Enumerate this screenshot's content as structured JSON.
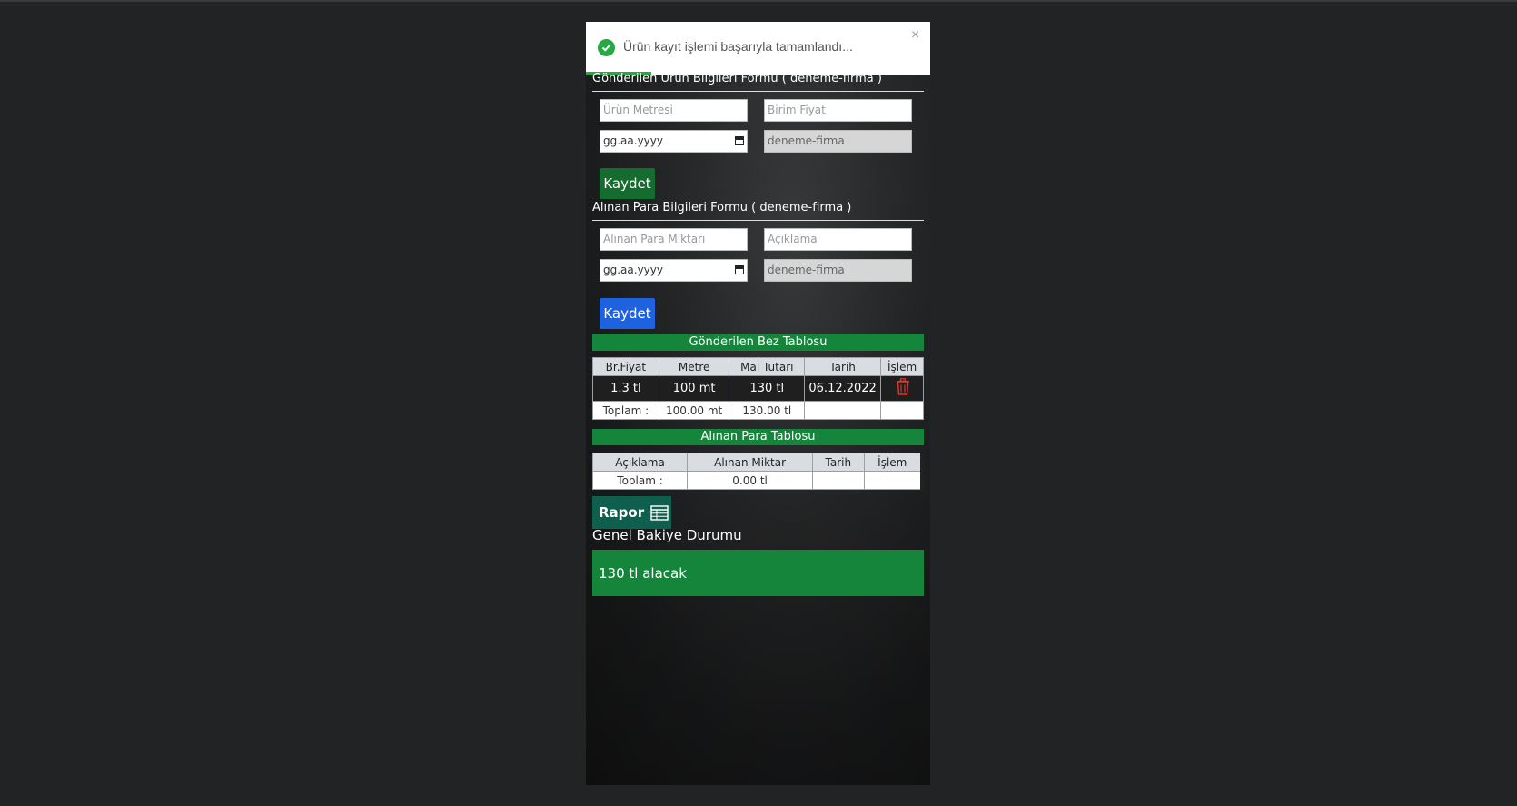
{
  "toast": {
    "message": "Ürün kayıt işlemi başarıyla tamamlandı...",
    "close": "×",
    "progress": 0.19
  },
  "product_form": {
    "title": "Gönderilen Ürün Bilgileri Formu ( deneme-firma )",
    "meter_placeholder": "Ürün Metresi",
    "unit_price_placeholder": "Birim Fiyat",
    "date_placeholder": "gg.aa.yyyy",
    "firm_value": "deneme-firma",
    "save_label": "Kaydet"
  },
  "payment_form": {
    "title": "Alınan Para Bilgileri Formu ( deneme-firma )",
    "amount_placeholder": "Alınan Para Miktarı",
    "description_placeholder": "Açıklama",
    "date_placeholder": "gg.aa.yyyy",
    "firm_value": "deneme-firma",
    "save_label": "Kaydet"
  },
  "sent_table": {
    "title": "Gönderilen Bez Tablosu",
    "headers": [
      "Br.Fiyat",
      "Metre",
      "Mal Tutarı",
      "Tarih",
      "İşlem"
    ],
    "rows": [
      {
        "unit_price": "1.3 tl",
        "meter": "100 mt",
        "amount": "130 tl",
        "date": "06.12.2022",
        "action_icon": "trash-icon"
      }
    ],
    "total": {
      "label": "Toplam :",
      "meter": "100.00 mt",
      "amount": "130.00 tl"
    }
  },
  "received_table": {
    "title": "Alınan Para Tablosu",
    "headers": [
      "Açıklama",
      "Alınan Miktar",
      "Tarih",
      "İşlem"
    ],
    "total": {
      "label": "Toplam :",
      "amount": "0.00 tl"
    }
  },
  "report": {
    "label": "Rapor",
    "icon": "table-icon"
  },
  "balance": {
    "title": "Genel Bakiye Durumu",
    "value": "130 tl alacak"
  },
  "colors": {
    "accent_green": "#16853c",
    "dark_green_button": "#146c2e",
    "blue_button": "#1f62e0",
    "report_button": "#0f5f4f",
    "trash_red": "#e0342b"
  }
}
